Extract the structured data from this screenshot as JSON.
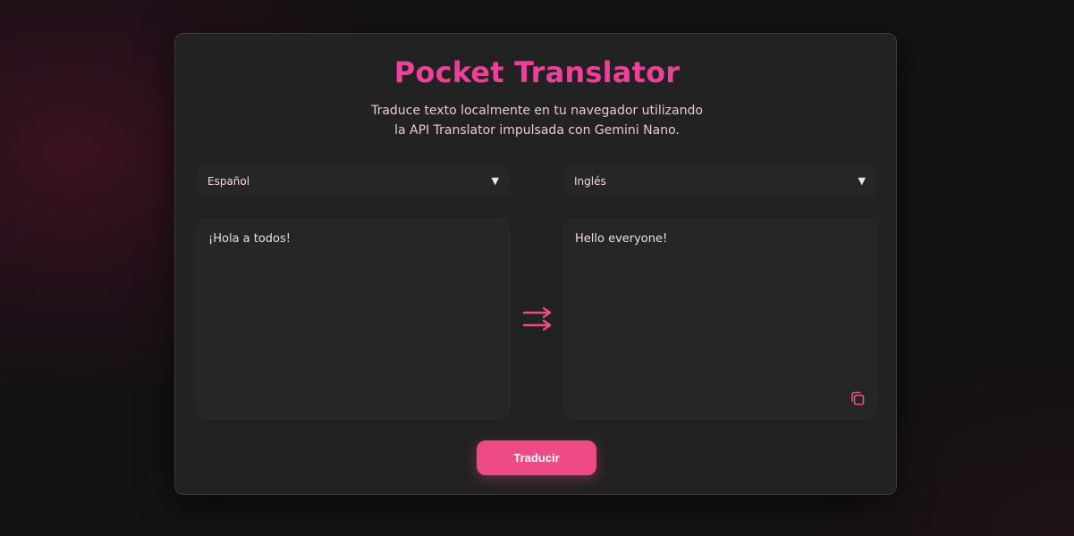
{
  "app": {
    "title": "Pocket Translator",
    "subtitle_lines": [
      "Traduce texto localmente en tu navegador utilizando",
      "la API Translator impulsada con Gemini Nano."
    ]
  },
  "source": {
    "language": "Español",
    "text": "¡Hola a todos!"
  },
  "target": {
    "language": "Inglés",
    "text": "Hello everyone!"
  },
  "actions": {
    "translate_label": "Traducir"
  },
  "icons": {
    "dropdown": "chevron-down-icon",
    "direction": "arrows-right-icon",
    "copy": "copy-icon"
  },
  "colors": {
    "accent": "#ee3f9b",
    "button": "#ee4a86",
    "card": "#222222",
    "background": "#131114"
  }
}
